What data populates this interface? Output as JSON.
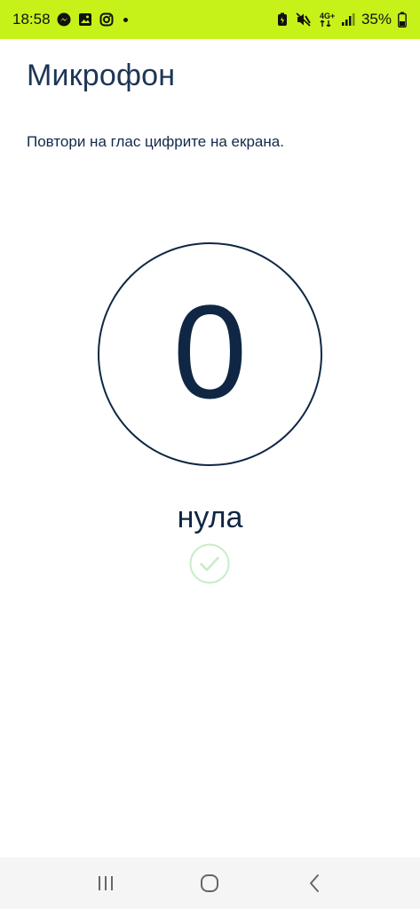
{
  "status_bar": {
    "time": "18:58",
    "battery": "35%",
    "network_label": "4G+",
    "icons": [
      "messenger-icon",
      "gallery-icon",
      "instagram-icon",
      "notification-dot-icon",
      "battery-saver-icon",
      "mute-icon",
      "network-icon",
      "signal-icon",
      "battery-icon"
    ],
    "background_color": "#c6f21a"
  },
  "page": {
    "title": "Микрофон",
    "instruction": "Повтори на глас цифрите на екрана."
  },
  "test": {
    "digit": "0",
    "word": "нула",
    "recognized": true,
    "check_color": "#c8ecc8"
  },
  "nav": {
    "items": [
      "recent-apps-icon",
      "home-icon",
      "back-icon"
    ]
  }
}
